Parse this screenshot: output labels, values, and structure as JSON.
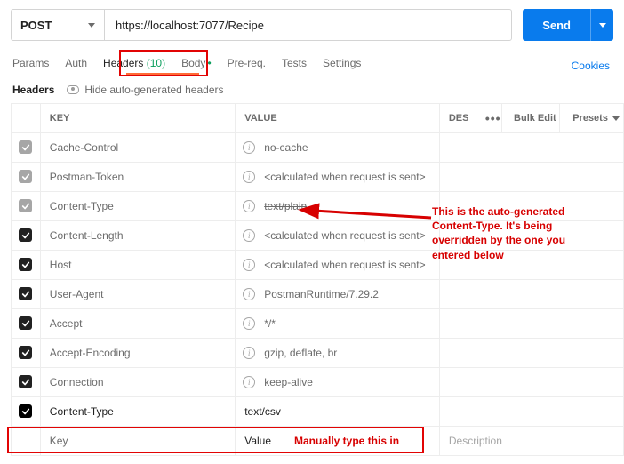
{
  "request": {
    "method": "POST",
    "url": "https://localhost:7077/Recipe",
    "send_label": "Send"
  },
  "links": {
    "cookies": "Cookies"
  },
  "tabs": [
    {
      "label": "Params"
    },
    {
      "label": "Auth"
    },
    {
      "label": "Headers",
      "count": "(10)",
      "active": true
    },
    {
      "label": "Body",
      "dot": true
    },
    {
      "label": "Pre-req."
    },
    {
      "label": "Tests"
    },
    {
      "label": "Settings"
    }
  ],
  "sub": {
    "title": "Headers",
    "hide_label": "Hide auto-generated headers"
  },
  "columns": {
    "key": "KEY",
    "value": "VALUE",
    "desc": "DES",
    "bulk": "Bulk Edit",
    "presets": "Presets",
    "dots": "•••"
  },
  "rows": [
    {
      "checked": "off",
      "auto": true,
      "key": "Cache-Control",
      "value": "no-cache"
    },
    {
      "checked": "off",
      "auto": true,
      "key": "Postman-Token",
      "value": "<calculated when request is sent>"
    },
    {
      "checked": "off",
      "auto": true,
      "key": "Content-Type",
      "value": "text/plain",
      "strike": true
    },
    {
      "checked": "on",
      "auto": true,
      "key": "Content-Length",
      "value": "<calculated when request is sent>"
    },
    {
      "checked": "on",
      "auto": true,
      "key": "Host",
      "value": "<calculated when request is sent>"
    },
    {
      "checked": "on",
      "auto": true,
      "key": "User-Agent",
      "value": "PostmanRuntime/7.29.2"
    },
    {
      "checked": "on",
      "auto": true,
      "key": "Accept",
      "value": "*/*"
    },
    {
      "checked": "on",
      "auto": true,
      "key": "Accept-Encoding",
      "value": "gzip, deflate, br"
    },
    {
      "checked": "on",
      "auto": true,
      "key": "Connection",
      "value": "keep-alive"
    },
    {
      "checked": "on",
      "auto": false,
      "key": "Content-Type",
      "value": "text/csv"
    }
  ],
  "new_row": {
    "key": "Key",
    "value": "Value",
    "desc": "Description"
  },
  "annotations": {
    "auto_note": "This is the auto-generated Content-Type. It's being overridden by the one you entered below",
    "manual_note": "Manually type this in"
  }
}
